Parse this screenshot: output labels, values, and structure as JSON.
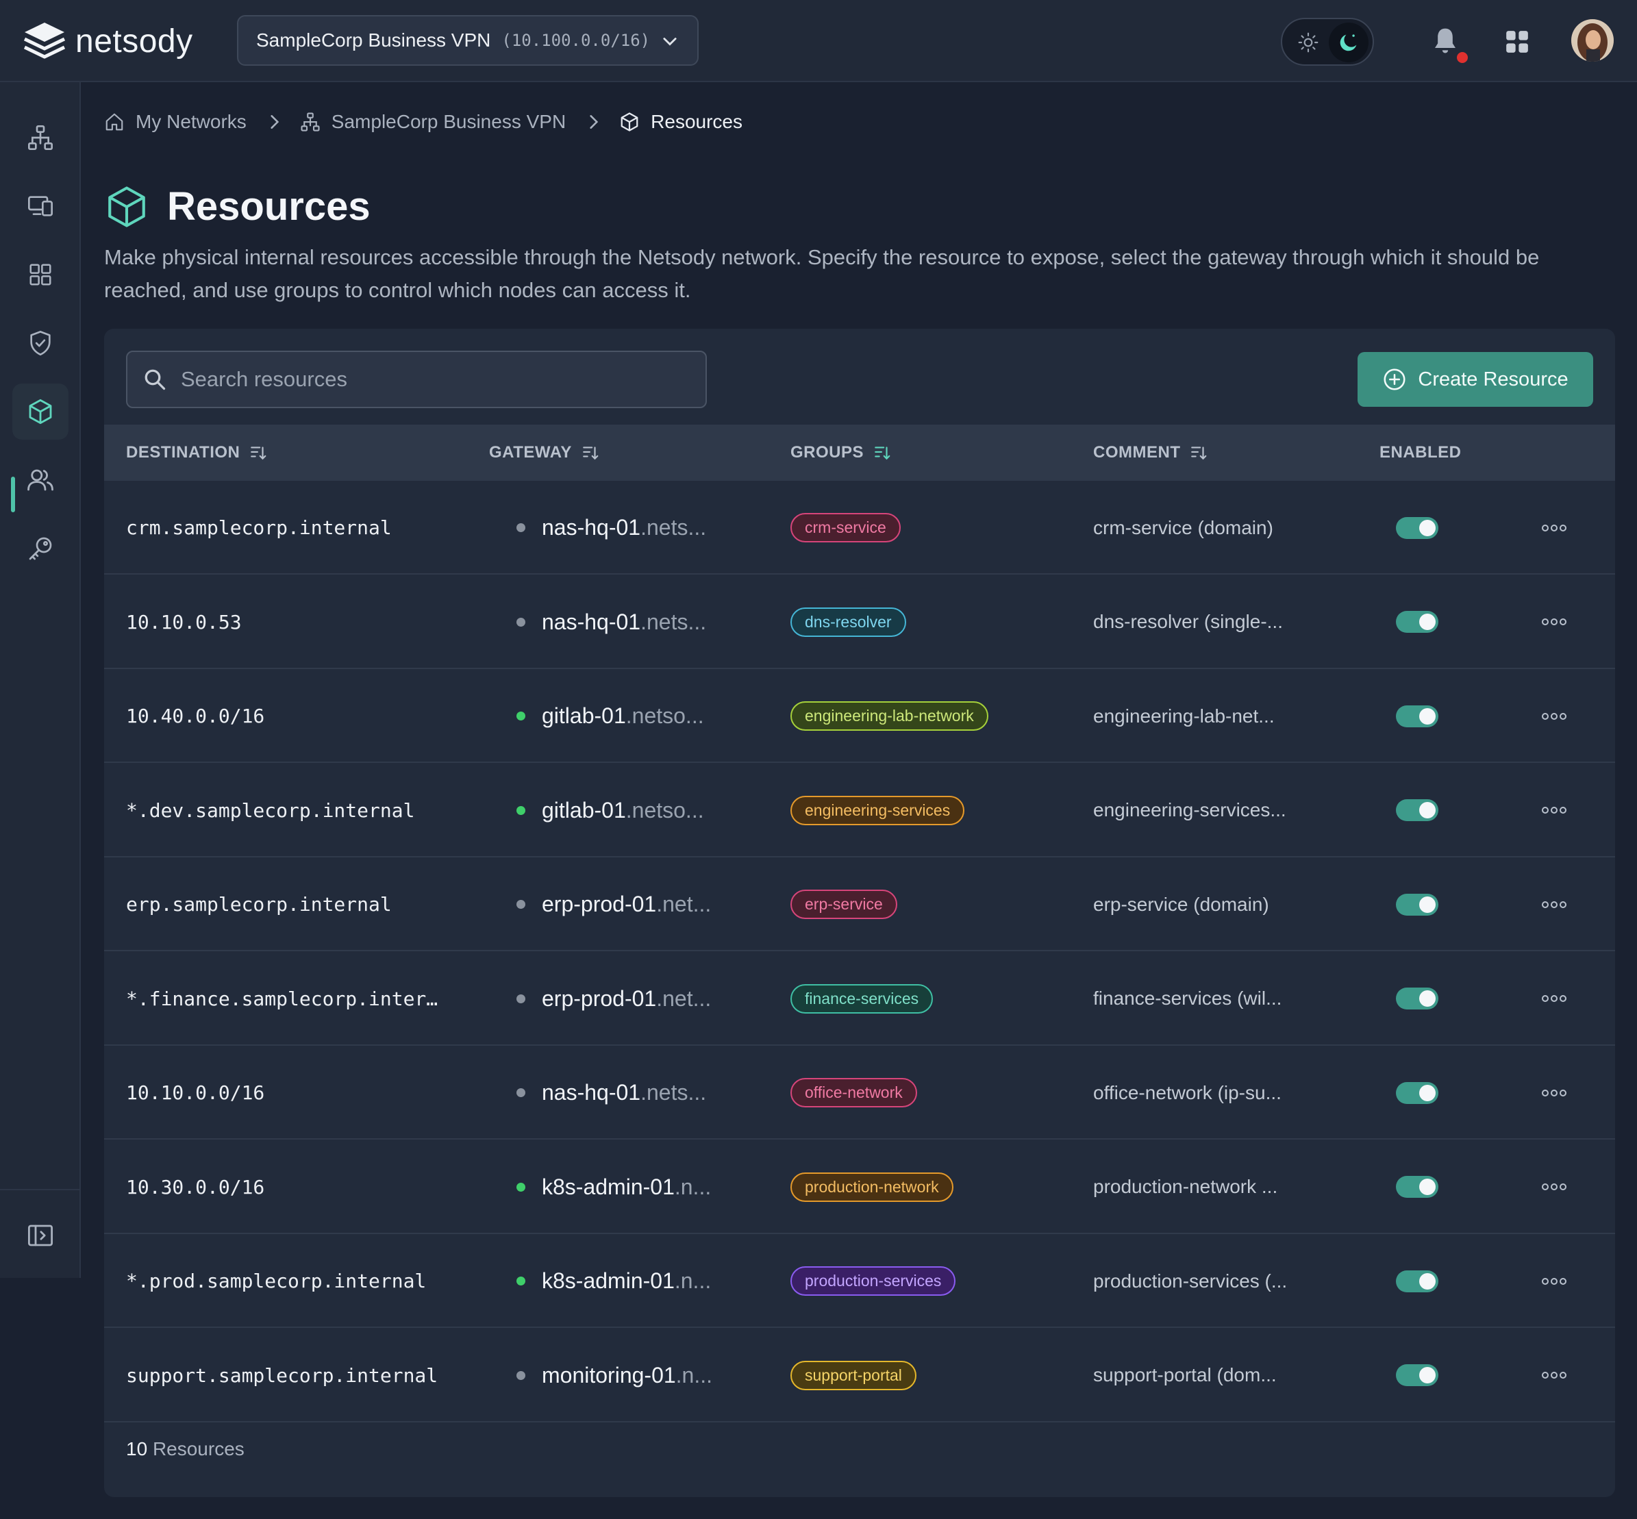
{
  "app": {
    "name": "netsody"
  },
  "network_selector": {
    "name": "SampleCorp Business VPN",
    "cidr": "(10.100.0.0/16)"
  },
  "breadcrumb": [
    "My Networks",
    "SampleCorp Business VPN",
    "Resources"
  ],
  "page": {
    "title": "Resources",
    "description": "Make physical internal resources accessible through the Netsody network. Specify the resource to expose, select the gateway through which it should be reached, and use groups to control which nodes can access it."
  },
  "search": {
    "placeholder": "Search resources"
  },
  "create_button": "Create Resource",
  "columns": [
    "DESTINATION",
    "GATEWAY",
    "GROUPS",
    "COMMENT",
    "ENABLED"
  ],
  "rows": [
    {
      "destination": "crm.samplecorp.internal",
      "gateway": "nas-hq-01",
      "gateway_domain": ".nets...",
      "gateway_online": false,
      "group": "crm-service",
      "group_color": "pink",
      "comment": "crm-service (domain)",
      "enabled": true
    },
    {
      "destination": "10.10.0.53",
      "gateway": "nas-hq-01",
      "gateway_domain": ".nets...",
      "gateway_online": false,
      "group": "dns-resolver",
      "group_color": "cyan",
      "comment": "dns-resolver (single-...",
      "enabled": true
    },
    {
      "destination": "10.40.0.0/16",
      "gateway": "gitlab-01",
      "gateway_domain": ".netso...",
      "gateway_online": true,
      "group": "engineering-lab-network",
      "group_color": "lime",
      "comment": "engineering-lab-net...",
      "enabled": true
    },
    {
      "destination": "*.dev.samplecorp.internal",
      "gateway": "gitlab-01",
      "gateway_domain": ".netso...",
      "gateway_online": true,
      "group": "engineering-services",
      "group_color": "orange",
      "comment": "engineering-services...",
      "enabled": true
    },
    {
      "destination": "erp.samplecorp.internal",
      "gateway": "erp-prod-01",
      "gateway_domain": ".net...",
      "gateway_online": false,
      "group": "erp-service",
      "group_color": "pink",
      "comment": "erp-service (domain)",
      "enabled": true
    },
    {
      "destination": "*.finance.samplecorp.inter…",
      "gateway": "erp-prod-01",
      "gateway_domain": ".net...",
      "gateway_online": false,
      "group": "finance-services",
      "group_color": "teal",
      "comment": "finance-services (wil...",
      "enabled": true
    },
    {
      "destination": "10.10.0.0/16",
      "gateway": "nas-hq-01",
      "gateway_domain": ".nets...",
      "gateway_online": false,
      "group": "office-network",
      "group_color": "pink",
      "comment": "office-network (ip-su...",
      "enabled": true
    },
    {
      "destination": "10.30.0.0/16",
      "gateway": "k8s-admin-01",
      "gateway_domain": ".n...",
      "gateway_online": true,
      "group": "production-network",
      "group_color": "orange",
      "comment": "production-network ...",
      "enabled": true
    },
    {
      "destination": "*.prod.samplecorp.internal",
      "gateway": "k8s-admin-01",
      "gateway_domain": ".n...",
      "gateway_online": true,
      "group": "production-services",
      "group_color": "purple",
      "comment": "production-services (...",
      "enabled": true
    },
    {
      "destination": "support.samplecorp.internal",
      "gateway": "monitoring-01",
      "gateway_domain": ".n...",
      "gateway_online": false,
      "group": "support-portal",
      "group_color": "yellow",
      "comment": "support-portal (dom...",
      "enabled": true
    }
  ],
  "footer": {
    "count": "10",
    "label": "Resources"
  },
  "colors": {
    "accent": "#3b8f80",
    "online": "#3fcf6a",
    "offline": "#8a929e",
    "badges": {
      "pink": {
        "bg": "#4a1f2e",
        "border": "#d6457a",
        "text": "#f07aa3"
      },
      "cyan": {
        "bg": "#173a46",
        "border": "#45b6d6",
        "text": "#7fd6ef"
      },
      "lime": {
        "bg": "#34461a",
        "border": "#a6d13a",
        "text": "#cde87a"
      },
      "orange": {
        "bg": "#4a3112",
        "border": "#e59a2b",
        "text": "#f4bd63"
      },
      "teal": {
        "bg": "#173f3a",
        "border": "#3fbfa4",
        "text": "#7fe0c9"
      },
      "purple": {
        "bg": "#3a1f66",
        "border": "#8a5cf0",
        "text": "#c3a5ff"
      },
      "yellow": {
        "bg": "#4a3c12",
        "border": "#e5b72b",
        "text": "#f5d468"
      }
    }
  },
  "icons": [
    "netsody-logo-icon",
    "chevron-down-icon",
    "sun-icon",
    "moon-icon",
    "bell-icon",
    "apps-grid-icon",
    "network-icon",
    "devices-icon",
    "dashboard-icon",
    "shield-icon",
    "cube-icon",
    "users-icon",
    "key-icon",
    "collapse-sidebar-icon",
    "home-icon",
    "chevron-right-icon",
    "search-icon",
    "plus-circle-icon",
    "sort-icon",
    "more-icon"
  ]
}
